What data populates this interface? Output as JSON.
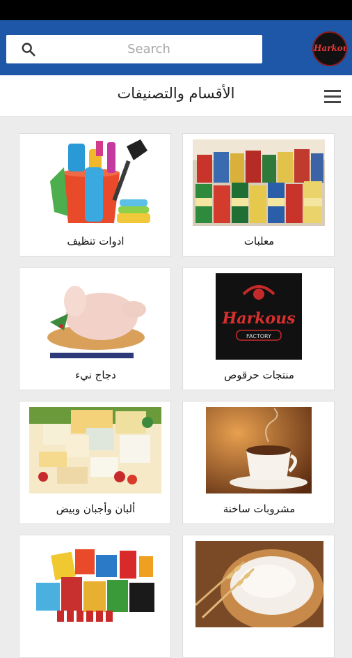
{
  "search": {
    "placeholder": "Search"
  },
  "brand": {
    "logo_text": "Harkous"
  },
  "header": {
    "title": "الأقسام والتصنيفات"
  },
  "categories": [
    {
      "label": "معلبات",
      "icon": "canned-goods-image"
    },
    {
      "label": "ادوات تنظيف",
      "icon": "cleaning-supplies-image"
    },
    {
      "label": "منتجات حرقوص",
      "icon": "harkous-products-image",
      "image_text": "Harkous",
      "image_subtext": "FACTORY"
    },
    {
      "label": "دجاج نيء",
      "icon": "raw-chicken-image"
    },
    {
      "label": "مشروبات ساخنة",
      "icon": "hot-drinks-image"
    },
    {
      "label": "ألبان وأجبان وبيض",
      "icon": "dairy-cheese-eggs-image"
    },
    {
      "label": "",
      "icon": "flour-image"
    },
    {
      "label": "",
      "icon": "snacks-image"
    }
  ]
}
